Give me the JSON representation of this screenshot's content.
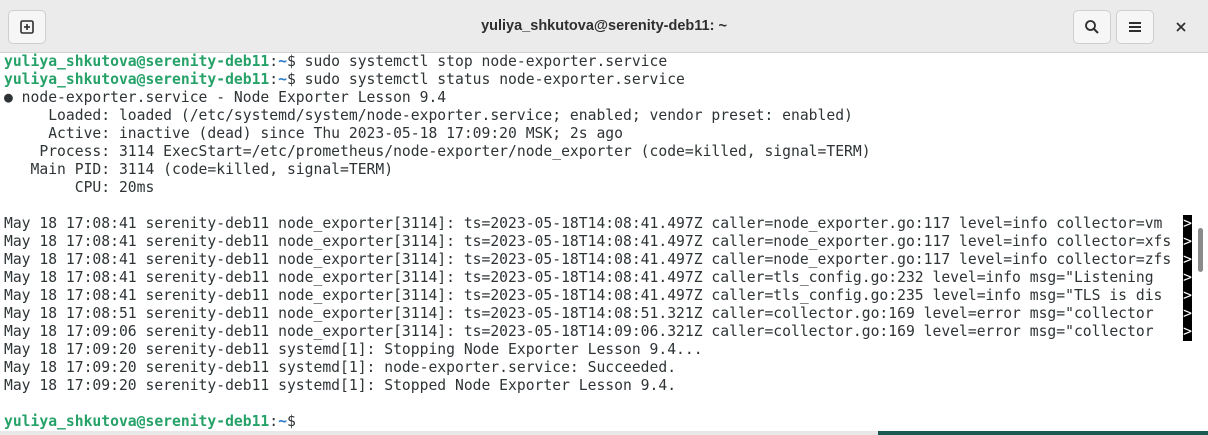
{
  "window": {
    "title": "yuliya_shkutova@serenity-deb11: ~"
  },
  "icons": {
    "new_tab": "new-tab-icon",
    "search": "search-icon",
    "menu": "hamburger-menu-icon",
    "close": "close-icon"
  },
  "colors": {
    "prompt_user": "#26a269",
    "prompt_path": "#2a7ac9",
    "text": "#2e3436",
    "background": "#ffffff",
    "titlebar": "#ebebeb"
  },
  "prompt": {
    "user_host": "yuliya_shkutova@serenity-deb11",
    "sep": ":",
    "cwd": "~",
    "sigil": "$"
  },
  "commands": [
    "sudo systemctl stop node-exporter.service",
    "sudo systemctl status node-exporter.service"
  ],
  "status_block": [
    "● node-exporter.service - Node Exporter Lesson 9.4",
    "     Loaded: loaded (/etc/systemd/system/node-exporter.service; enabled; vendor preset: enabled)",
    "     Active: inactive (dead) since Thu 2023-05-18 17:09:20 MSK; 2s ago",
    "    Process: 3114 ExecStart=/etc/prometheus/node-exporter/node_exporter (code=killed, signal=TERM)",
    "   Main PID: 3114 (code=killed, signal=TERM)",
    "        CPU: 20ms"
  ],
  "journal": [
    "May 18 17:08:41 serenity-deb11 node_exporter[3114]: ts=2023-05-18T14:08:41.497Z caller=node_exporter.go:117 level=info collector=vm",
    "May 18 17:08:41 serenity-deb11 node_exporter[3114]: ts=2023-05-18T14:08:41.497Z caller=node_exporter.go:117 level=info collector=xfs",
    "May 18 17:08:41 serenity-deb11 node_exporter[3114]: ts=2023-05-18T14:08:41.497Z caller=node_exporter.go:117 level=info collector=zfs",
    "May 18 17:08:41 serenity-deb11 node_exporter[3114]: ts=2023-05-18T14:08:41.497Z caller=tls_config.go:232 level=info msg=\"Listening ",
    "May 18 17:08:41 serenity-deb11 node_exporter[3114]: ts=2023-05-18T14:08:41.497Z caller=tls_config.go:235 level=info msg=\"TLS is dis",
    "May 18 17:08:51 serenity-deb11 node_exporter[3114]: ts=2023-05-18T14:08:51.321Z caller=collector.go:169 level=error msg=\"collector ",
    "May 18 17:09:06 serenity-deb11 node_exporter[3114]: ts=2023-05-18T14:09:06.321Z caller=collector.go:169 level=error msg=\"collector ",
    "May 18 17:09:20 serenity-deb11 systemd[1]: Stopping Node Exporter Lesson 9.4...",
    "May 18 17:09:20 serenity-deb11 systemd[1]: node-exporter.service: Succeeded.",
    "May 18 17:09:20 serenity-deb11 systemd[1]: Stopped Node Exporter Lesson 9.4."
  ],
  "truncation_marker": ">"
}
